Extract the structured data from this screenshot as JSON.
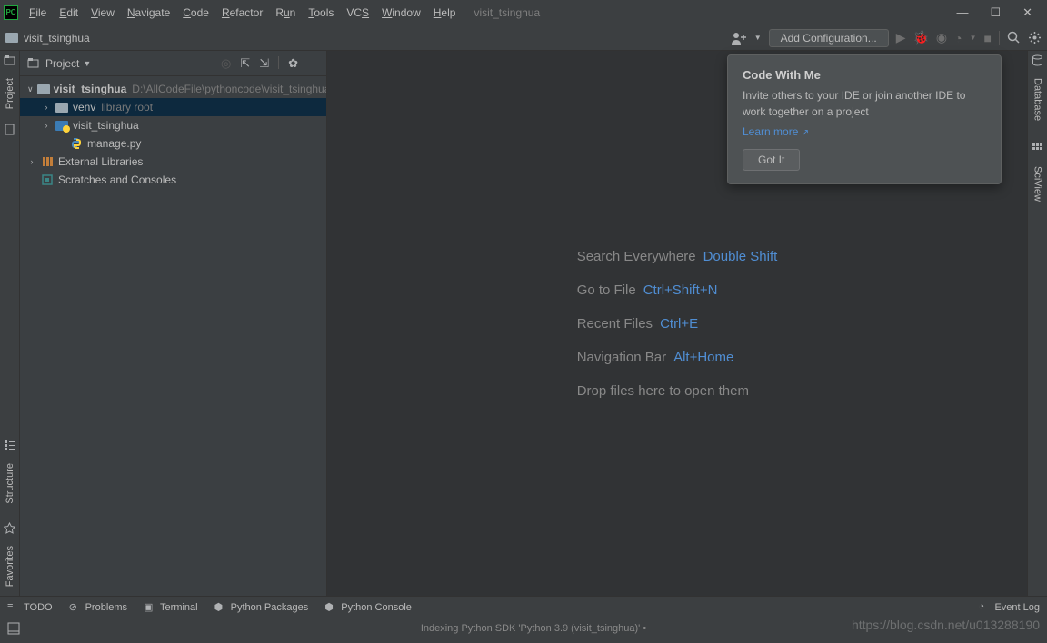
{
  "app": {
    "title": "visit_tsinghua"
  },
  "menu": [
    "File",
    "Edit",
    "View",
    "Navigate",
    "Code",
    "Refactor",
    "Run",
    "Tools",
    "VCS",
    "Window",
    "Help"
  ],
  "nav": {
    "project": "visit_tsinghua",
    "add_config": "Add Configuration..."
  },
  "project_panel": {
    "title": "Project",
    "root": {
      "name": "visit_tsinghua",
      "path": "D:\\AllCodeFile\\pythoncode\\visit_tsinghua"
    },
    "venv": {
      "name": "venv",
      "hint": "library root"
    },
    "sub": {
      "name": "visit_tsinghua"
    },
    "file": {
      "name": "manage.py"
    },
    "ext": "External Libraries",
    "scratch": "Scratches and Consoles"
  },
  "hints": [
    {
      "label": "Search Everywhere",
      "shortcut": "Double Shift"
    },
    {
      "label": "Go to File",
      "shortcut": "Ctrl+Shift+N"
    },
    {
      "label": "Recent Files",
      "shortcut": "Ctrl+E"
    },
    {
      "label": "Navigation Bar",
      "shortcut": "Alt+Home"
    }
  ],
  "drop_hint": "Drop files here to open them",
  "popup": {
    "title": "Code With Me",
    "text": "Invite others to your IDE or join another IDE to work together on a project",
    "link": "Learn more",
    "button": "Got It"
  },
  "left_tabs": {
    "project": "Project",
    "structure": "Structure",
    "favorites": "Favorites"
  },
  "right_tabs": {
    "database": "Database",
    "sciview": "SciView"
  },
  "bottom_tabs": {
    "todo": "TODO",
    "problems": "Problems",
    "terminal": "Terminal",
    "packages": "Python Packages",
    "console": "Python Console",
    "eventlog": "Event Log"
  },
  "status": {
    "center": "Indexing Python SDK 'Python 3.9 (visit_tsinghua)'  •"
  },
  "watermark": "https://blog.csdn.net/u013288190"
}
